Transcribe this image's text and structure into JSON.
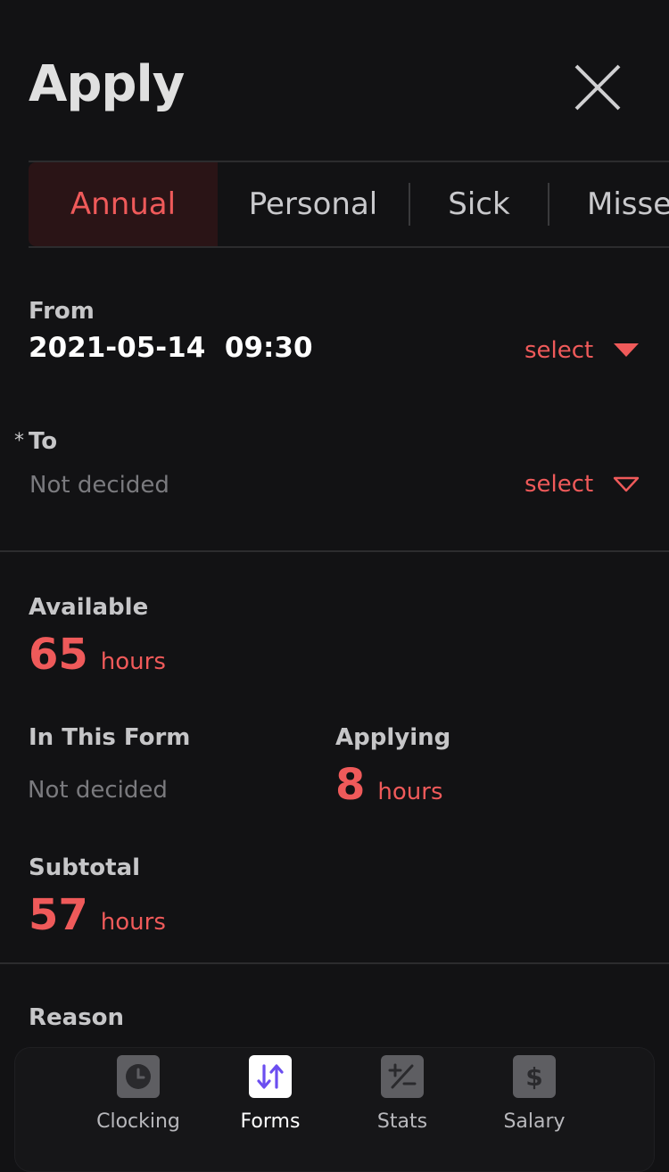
{
  "header": {
    "title": "Apply"
  },
  "tabs": [
    {
      "label": "Annual",
      "active": true
    },
    {
      "label": "Personal",
      "active": false
    },
    {
      "label": "Sick",
      "active": false
    },
    {
      "label": "Misse",
      "active": false
    }
  ],
  "from": {
    "label": "From",
    "value": "2021-05-14  09:30",
    "select_label": "select"
  },
  "to": {
    "required_mark": "*",
    "label": "To",
    "value": "Not decided",
    "select_label": "select"
  },
  "available": {
    "label": "Available",
    "value": "65",
    "unit": "hours"
  },
  "in_this_form": {
    "label": "In This Form",
    "value": "Not decided"
  },
  "applying": {
    "label": "Applying",
    "value": "8",
    "unit": "hours"
  },
  "subtotal": {
    "label": "Subtotal",
    "value": "57",
    "unit": "hours"
  },
  "reason": {
    "label": "Reason"
  },
  "bottom_nav": [
    {
      "label": "Clocking",
      "icon": "clock-icon",
      "active": false
    },
    {
      "label": "Forms",
      "icon": "swap-arrows-icon",
      "active": true
    },
    {
      "label": "Stats",
      "icon": "plus-minus-icon",
      "active": false
    },
    {
      "label": "Salary",
      "icon": "dollar-icon",
      "active": false
    }
  ],
  "colors": {
    "accent": "#ef5a5a",
    "background": "#121214",
    "active_tab_bg": "#2a1416",
    "nav_active_icon": "#6b4ef0"
  }
}
